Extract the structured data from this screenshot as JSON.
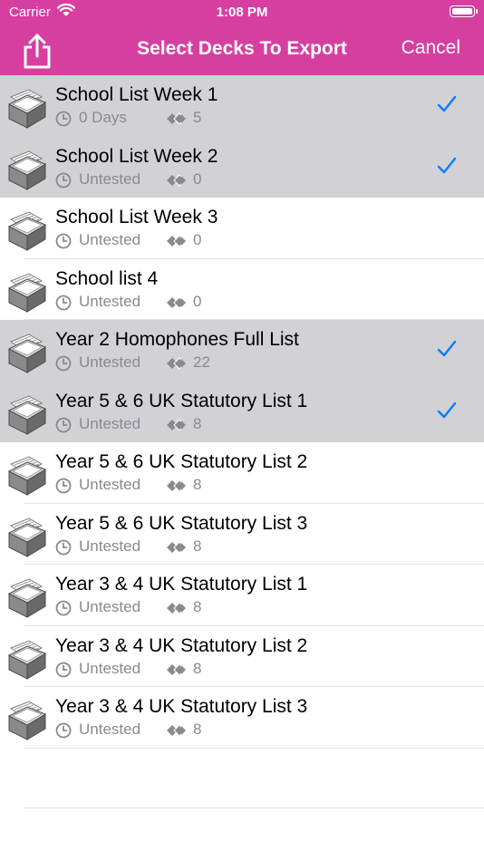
{
  "status_bar": {
    "carrier": "Carrier",
    "time": "1:08 PM"
  },
  "nav": {
    "title": "Select Decks To Export",
    "cancel_label": "Cancel"
  },
  "colors": {
    "accent": "#d63fa0",
    "check": "#0a7cff",
    "selected_row": "#d1d1d6",
    "meta_text": "#8a8a8e"
  },
  "decks": [
    {
      "title": "School List Week 1",
      "status": "0 Days",
      "count": "5",
      "selected": true
    },
    {
      "title": "School List Week 2",
      "status": "Untested",
      "count": "0",
      "selected": true
    },
    {
      "title": "School List Week 3",
      "status": "Untested",
      "count": "0",
      "selected": false
    },
    {
      "title": "School list 4",
      "status": "Untested",
      "count": "0",
      "selected": false
    },
    {
      "title": "Year 2 Homophones Full List",
      "status": "Untested",
      "count": "22",
      "selected": true
    },
    {
      "title": "Year 5 & 6 UK Statutory List 1",
      "status": "Untested",
      "count": "8",
      "selected": true
    },
    {
      "title": "Year 5 & 6 UK Statutory List 2",
      "status": "Untested",
      "count": "8",
      "selected": false
    },
    {
      "title": "Year 5 & 6 UK Statutory List 3",
      "status": "Untested",
      "count": "8",
      "selected": false
    },
    {
      "title": "Year 3 & 4 UK Statutory List 1",
      "status": "Untested",
      "count": "8",
      "selected": false
    },
    {
      "title": "Year 3 & 4 UK Statutory List 2",
      "status": "Untested",
      "count": "8",
      "selected": false
    },
    {
      "title": "Year 3 & 4 UK Statutory List 3",
      "status": "Untested",
      "count": "8",
      "selected": false
    }
  ]
}
